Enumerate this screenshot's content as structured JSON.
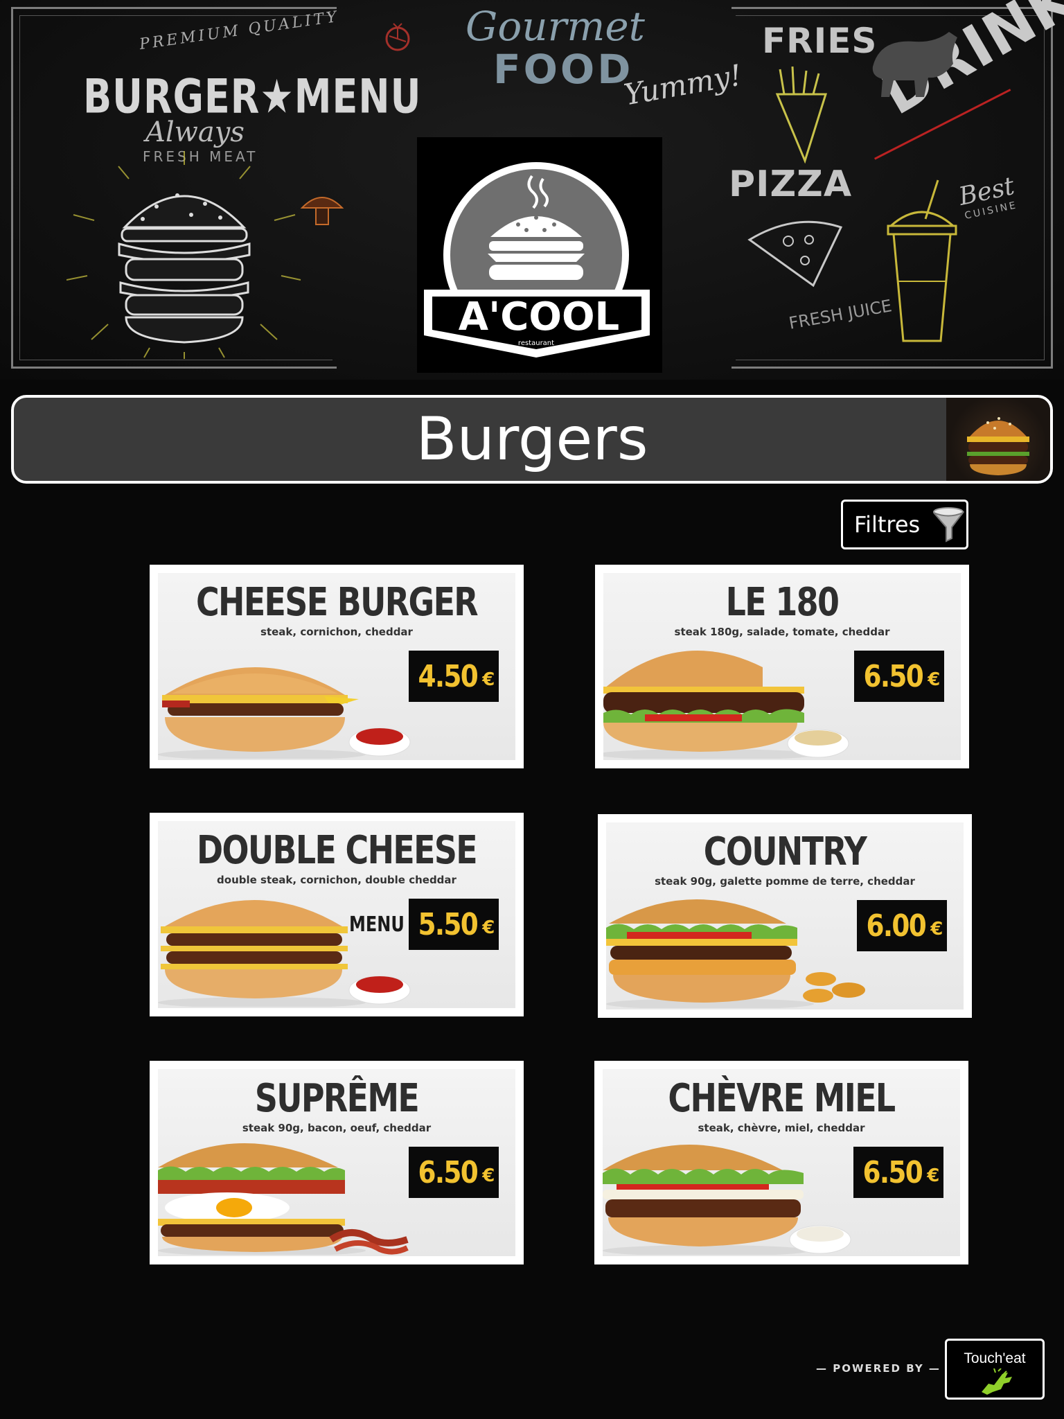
{
  "banner": {
    "burger_menu": {
      "premium": "PREMIUM QUALITY",
      "gourmet": "GOURMET",
      "title": "BURGER★MENU",
      "always": "Always",
      "fresh_meat": "FRESH MEAT"
    },
    "gourmet_food": {
      "gourmet": "Gourmet",
      "food": "FOOD"
    },
    "yummy": "Yummy!",
    "fries": "FRIES",
    "pizza": "PIZZA",
    "drinks": "DRINKS",
    "fresh_juice": "FRESH JUICE",
    "best": "Best",
    "cuisine": "CUISINE"
  },
  "logo": {
    "name": "A'COOL",
    "tagline": "restaurant"
  },
  "category": {
    "title": "Burgers",
    "thumb_icon": "burger-photo"
  },
  "filter": {
    "label": "Filtres",
    "icon": "funnel-icon"
  },
  "colors": {
    "background": "#080808",
    "price": "#f2c230",
    "category_bar": "#3a3a3a"
  },
  "products": [
    {
      "name": "CHEESE BURGER",
      "desc": "steak, cornichon, cheddar",
      "price": "4.50",
      "currency": "€",
      "side": "ketchup"
    },
    {
      "name": "LE 180",
      "desc": "steak 180g, salade, tomate, cheddar",
      "price": "6.50",
      "currency": "€",
      "side": "sauce"
    },
    {
      "name": "DOUBLE CHEESE",
      "desc": "double steak, cornichon, double cheddar",
      "price": "5.50",
      "currency": "€",
      "menu_label": "MENU",
      "side": "ketchup"
    },
    {
      "name": "COUNTRY",
      "desc": "steak 90g, galette pomme de terre, cheddar",
      "price": "6.00",
      "currency": "€",
      "side": "potato"
    },
    {
      "name": "SUPRÊME",
      "desc": "steak 90g, bacon, oeuf, cheddar",
      "price": "6.50",
      "currency": "€",
      "side": "bacon"
    },
    {
      "name": "CHÈVRE MIEL",
      "desc": "steak, chèvre, miel,  cheddar",
      "price": "6.50",
      "currency": "€",
      "side": "cream"
    }
  ],
  "footer": {
    "powered_by": "— POWERED BY —",
    "brand": "Touch'eat"
  }
}
